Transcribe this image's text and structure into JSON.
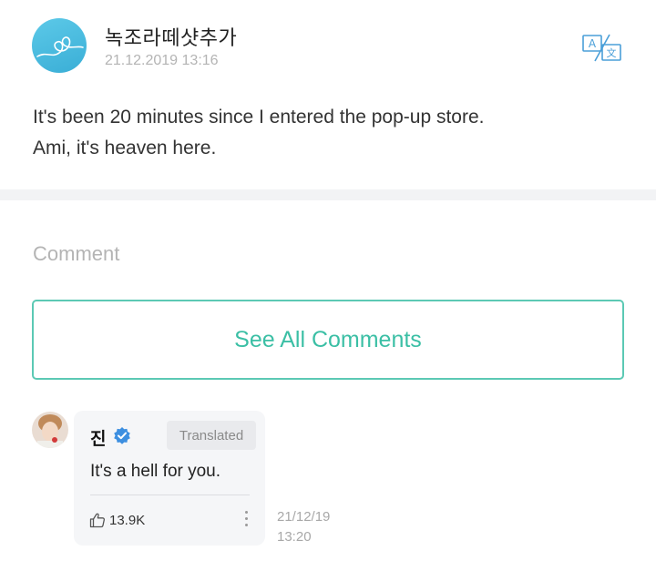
{
  "post": {
    "author_name": "녹조라떼샷추가",
    "date": "21.12.2019 13:16",
    "body": "It's been 20 minutes since I entered the pop-up store.\n Ami, it's heaven here.",
    "translate_icon": "translate-icon"
  },
  "comments_section": {
    "heading": "Comment",
    "see_all_label": "See All Comments"
  },
  "comment": {
    "author_name": "진",
    "verified_icon": "verified-check-icon",
    "translated_badge": "Translated",
    "text": "It's a hell for you.",
    "like_count": "13.9K",
    "time": "21/12/19\n13:20"
  },
  "colors": {
    "accent": "#3bbfa5",
    "accent_border": "#5cc9b4",
    "verified": "#3d8fe0",
    "muted": "#b4b4b4"
  }
}
